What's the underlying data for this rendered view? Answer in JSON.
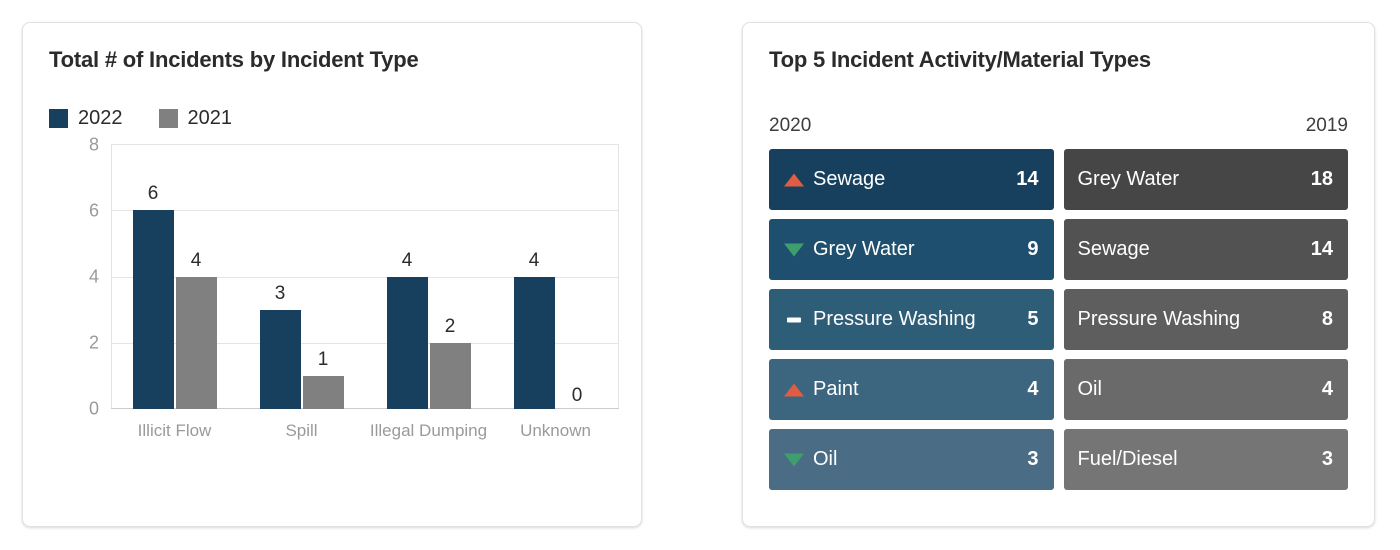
{
  "left_card": {
    "title": "Total # of Incidents by Incident Type",
    "legend": [
      {
        "label": "2022",
        "color": "#17405f"
      },
      {
        "label": "2021",
        "color": "#808080"
      }
    ]
  },
  "chart_data": {
    "type": "bar",
    "title": "Total # of Incidents by Incident Type",
    "xlabel": "",
    "ylabel": "",
    "ylim": [
      0,
      8
    ],
    "yticks": [
      0,
      2,
      4,
      6,
      8
    ],
    "grid": true,
    "legend_position": "top-left",
    "categories": [
      "Illicit Flow",
      "Spill",
      "Illegal Dumping",
      "Unknown"
    ],
    "series": [
      {
        "name": "2022",
        "color": "#17405f",
        "values": [
          6,
          3,
          4,
          4
        ]
      },
      {
        "name": "2021",
        "color": "#808080",
        "values": [
          4,
          1,
          2,
          0
        ]
      }
    ]
  },
  "right_card": {
    "title": "Top 5 Incident Activity/Material Types",
    "year_left": "2020",
    "year_right": "2019",
    "columns": [
      {
        "name": "col-2020",
        "rows": [
          {
            "icon": "triangle-up-icon",
            "label": "Sewage",
            "value": "14",
            "color": "#16405e"
          },
          {
            "icon": "triangle-down-icon",
            "label": "Grey Water",
            "value": "9",
            "color": "#1f4f6e"
          },
          {
            "icon": "dash-icon",
            "label": "Pressure Washing",
            "value": "5",
            "color": "#2e5d78"
          },
          {
            "icon": "triangle-up-icon",
            "label": "Paint",
            "value": "4",
            "color": "#3c6680"
          },
          {
            "icon": "triangle-down-icon",
            "label": "Oil",
            "value": "3",
            "color": "#4a6c85"
          }
        ]
      },
      {
        "name": "col-2019",
        "rows": [
          {
            "icon": "none",
            "label": "Grey Water",
            "value": "18",
            "color": "#464646"
          },
          {
            "icon": "none",
            "label": "Sewage",
            "value": "14",
            "color": "#525252"
          },
          {
            "icon": "none",
            "label": "Pressure Washing",
            "value": "8",
            "color": "#5e5e5e"
          },
          {
            "icon": "none",
            "label": "Oil",
            "value": "4",
            "color": "#6a6a6a"
          },
          {
            "icon": "none",
            "label": "Fuel/Diesel",
            "value": "3",
            "color": "#757575"
          }
        ]
      }
    ]
  }
}
